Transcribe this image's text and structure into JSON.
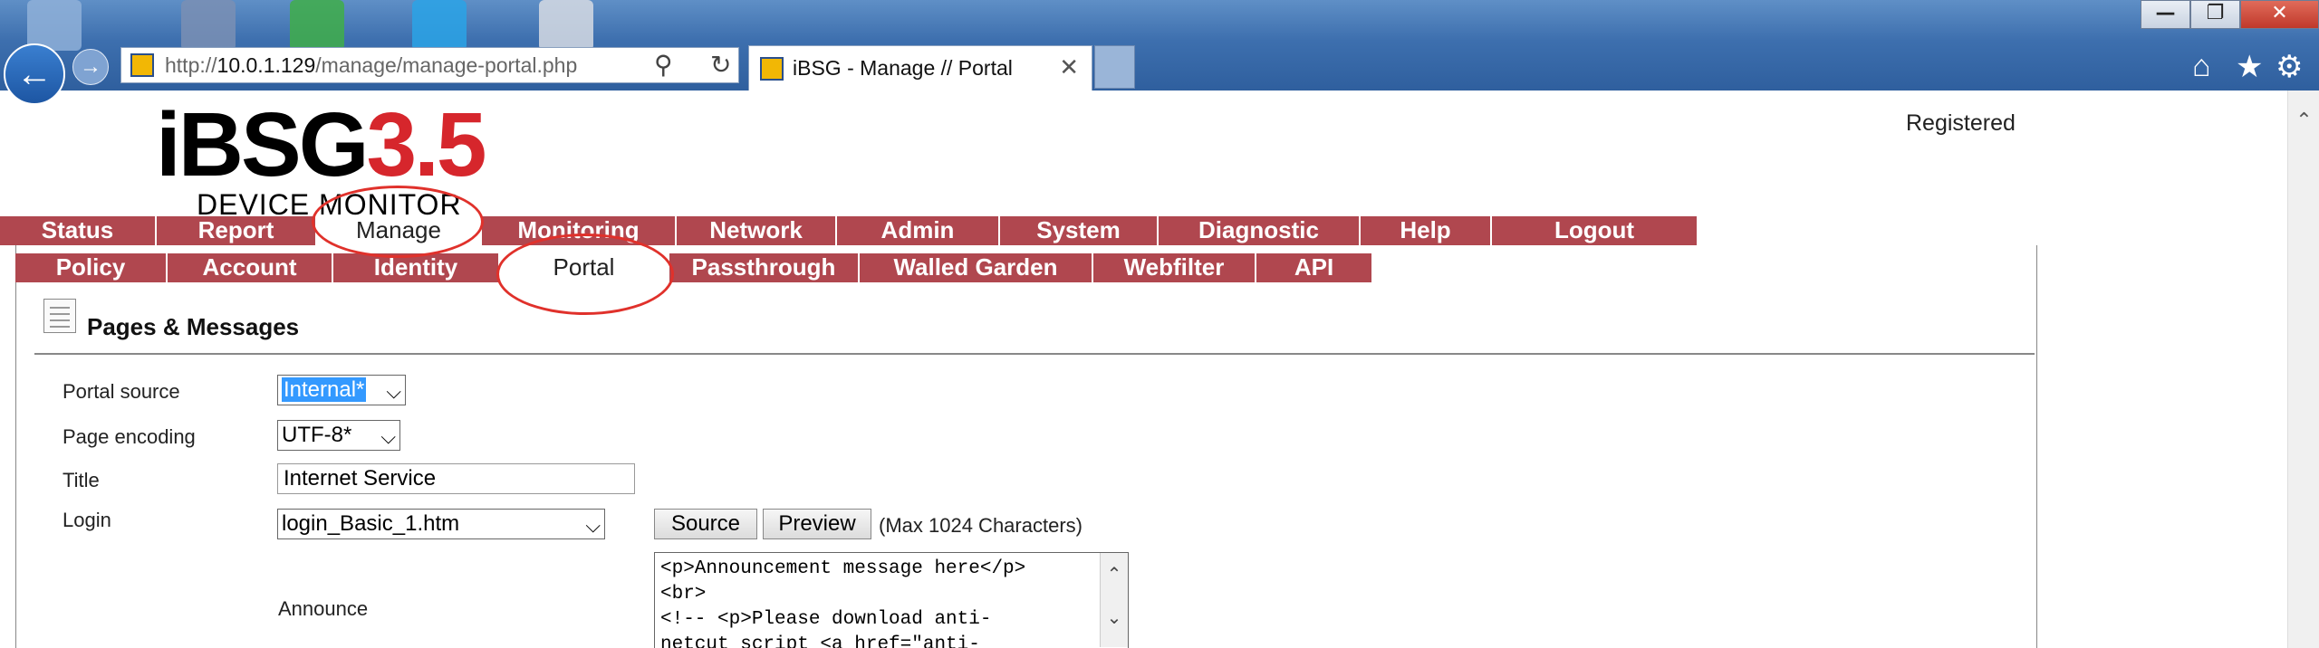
{
  "browser": {
    "url_prefix": "http://",
    "url_host": "10.0.1.129",
    "url_path": "/manage/manage-portal.php",
    "tab_title": "iBSG - Manage // Portal",
    "tab_close": "✕",
    "window_buttons": [
      "—",
      "❐",
      "✕"
    ],
    "back_glyph": "←",
    "forward_glyph": "→",
    "search_glyph": "⚲",
    "refresh_glyph": "↻",
    "toolbar_icons": [
      "⌂",
      "★",
      "⚙"
    ]
  },
  "header": {
    "logo_main": "iBSG",
    "logo_version": "3.5",
    "logo_sub": "DEVICE MONITOR",
    "registered": "Registered"
  },
  "main_menu": [
    {
      "label": "Status"
    },
    {
      "label": "Report"
    },
    {
      "label": "Manage",
      "active": true
    },
    {
      "label": "Monitoring"
    },
    {
      "label": "Network"
    },
    {
      "label": "Admin"
    },
    {
      "label": "System"
    },
    {
      "label": "Diagnostic"
    },
    {
      "label": "Help"
    },
    {
      "label": "Logout"
    }
  ],
  "sub_menu": [
    {
      "label": "Policy"
    },
    {
      "label": "Account"
    },
    {
      "label": "Identity"
    },
    {
      "label": "Portal",
      "active": true
    },
    {
      "label": "Passthrough"
    },
    {
      "label": "Walled Garden"
    },
    {
      "label": "Webfilter"
    },
    {
      "label": "API"
    }
  ],
  "section": {
    "title": "Pages & Messages"
  },
  "form": {
    "portal_source_label": "Portal source",
    "portal_source_value": "Internal*",
    "page_encoding_label": "Page encoding",
    "page_encoding_value": "UTF-8*",
    "title_label": "Title",
    "title_value": "Internet Service",
    "login_label": "Login",
    "login_value": "login_Basic_1.htm",
    "source_button": "Source",
    "preview_button": "Preview",
    "max_chars": "(Max 1024 Characters)",
    "announce_label": "Announce",
    "announce_text": "<p>Announcement message here</p>\n<br>\n<!-- <p>Please download anti-\nnetcut script <a href=\"anti-"
  },
  "colors": {
    "menu_bg": "#b0474f",
    "accent_red": "#d6262c",
    "annotation_circle": "#e0312b"
  }
}
